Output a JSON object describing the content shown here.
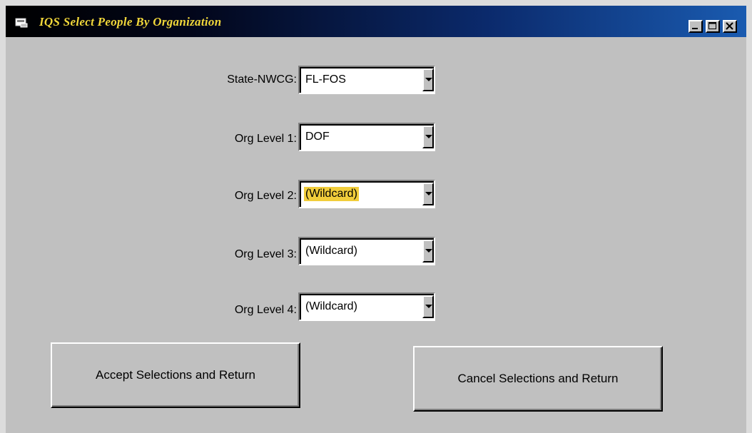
{
  "window": {
    "title": "IQS  Select People By Organization",
    "app_icon": "window-app-icon",
    "controls": {
      "minimize_icon": "minimize-icon",
      "maximize_icon": "maximize-icon",
      "close_icon": "close-icon"
    },
    "title_color": "#f2d83a"
  },
  "form": {
    "fields": [
      {
        "label": "State-NWCG:",
        "value": "FL-FOS"
      },
      {
        "label": "Org Level 1:",
        "value": "DOF"
      },
      {
        "label": "Org Level 2:",
        "value": "(Wildcard)",
        "selected": true
      },
      {
        "label": "Org Level 3:",
        "value": "(Wildcard)"
      },
      {
        "label": "Org Level 4:",
        "value": "(Wildcard)"
      }
    ],
    "dropdown_icon": "chevron-down-icon",
    "highlight_color": "#f1cd3b"
  },
  "buttons": {
    "accept_label": "Accept Selections and Return",
    "cancel_label": "Cancel Selections and Return"
  }
}
